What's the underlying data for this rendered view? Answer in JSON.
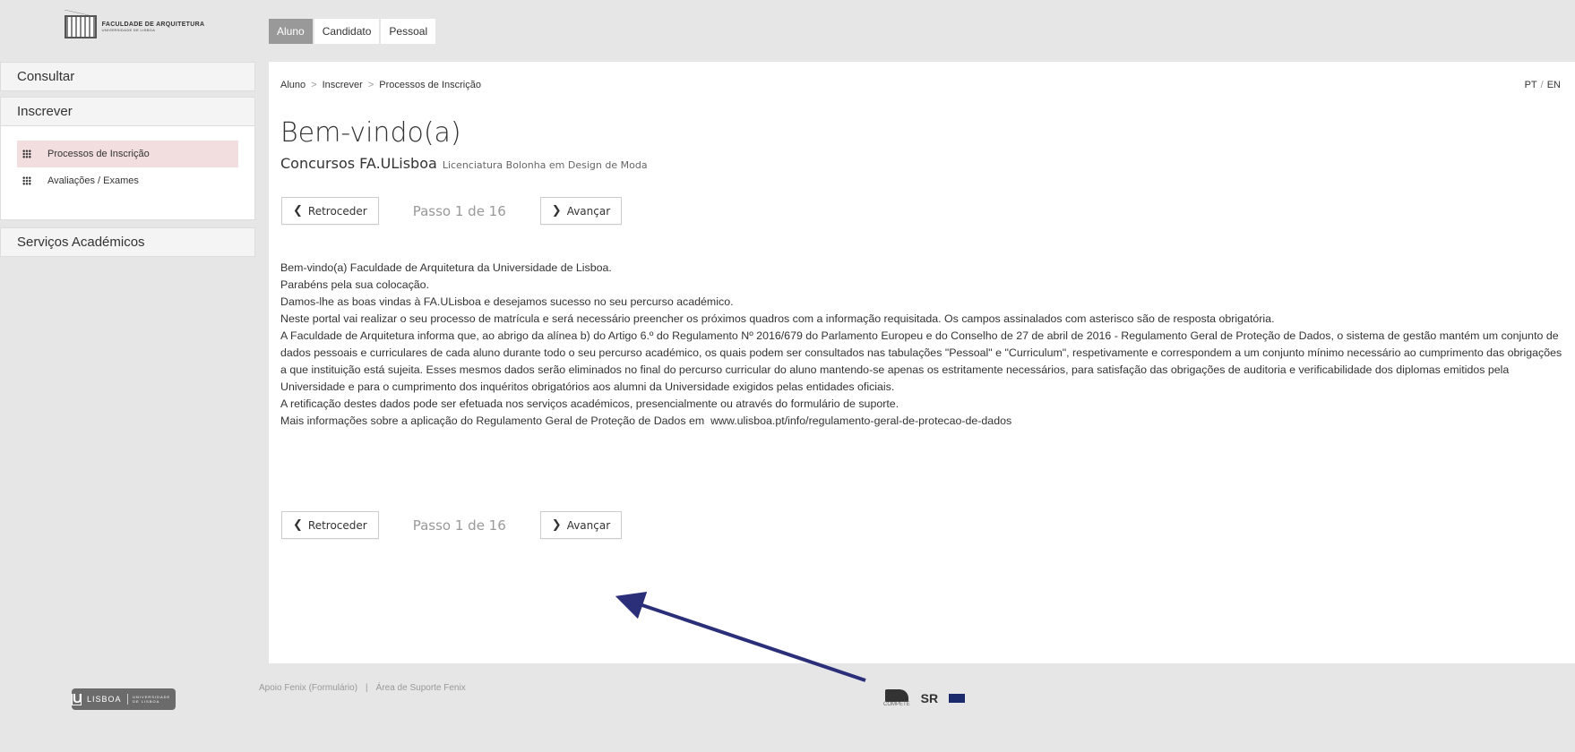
{
  "header": {
    "logo_text": "FACULDADE DE ARQUITETURA",
    "logo_subtext": "UNIVERSIDADE DE LISBOA",
    "tabs": [
      {
        "label": "Aluno",
        "active": true
      },
      {
        "label": "Candidato",
        "active": false
      },
      {
        "label": "Pessoal",
        "active": false
      }
    ]
  },
  "sidebar": {
    "consultar": "Consultar",
    "inscrever": "Inscrever",
    "items": [
      {
        "label": "Processos de Inscrição",
        "active": true
      },
      {
        "label": "Avaliações / Exames",
        "active": false
      }
    ],
    "servicos": "Serviços Académicos"
  },
  "breadcrumb": [
    "Aluno",
    "Inscrever",
    "Processos de Inscrição"
  ],
  "lang": {
    "pt": "PT",
    "en": "EN"
  },
  "page": {
    "title": "Bem-vindo(a)",
    "subtitle": "Concursos FA.ULisboa",
    "subtitle_small": "Licenciatura Bolonha em Design de Moda"
  },
  "nav": {
    "back": "Retroceder",
    "step": "Passo 1 de 16",
    "next": "Avançar"
  },
  "body": [
    "Bem-vindo(a) Faculdade de Arquitetura da Universidade de Lisboa.",
    "Parabéns pela sua colocação.",
    "Damos-lhe as boas vindas à FA.ULisboa e desejamos sucesso no seu percurso académico.",
    "Neste portal vai realizar o seu processo de matrícula e será necessário preencher os próximos quadros com a informação requisitada. Os campos assinalados com asterisco são de resposta obrigatória.",
    "A Faculdade de Arquitetura informa que, ao abrigo da alínea b) do Artigo 6.º do Regulamento Nº 2016/679 do Parlamento Europeu e do Conselho de 27 de abril de 2016 - Regulamento Geral de Proteção de Dados, o sistema de gestão mantém um conjunto de dados pessoais e curriculares de cada aluno durante todo o seu percurso académico, os quais podem ser consultados nas tabulações \"Pessoal\" e \"Curriculum\", respetivamente e correspondem a um conjunto mínimo necessário ao cumprimento das obrigações a que instituição está sujeita. Esses mesmos dados serão eliminados no final do percurso curricular do aluno mantendo-se apenas os estritamente necessários, para satisfação das obrigações de auditoria e verificabilidade dos diplomas emitidos pela Universidade e para o cumprimento dos inquéritos obrigatórios aos alumni da Universidade exigidos pelas entidades oficiais.",
    "A retificação destes dados pode ser efetuada nos serviços académicos, presencialmente ou através do formulário de suporte."
  ],
  "body_last_prefix": "Mais informações sobre a aplicação do Regulamento Geral de Proteção de Dados em",
  "body_link": "www.ulisboa.pt/info/regulamento-geral-de-protecao-de-dados",
  "footer": {
    "lisboa_u": "U",
    "lisboa_text": "LISBOA",
    "lisboa_small": "UNIVERSIDADE DE LISBOA",
    "link1": "Apoio Fenix (Formulário)",
    "sep": "|",
    "link2": "Área de Suporte Fenix",
    "partner1": "COMPETE",
    "partner2": "SR",
    "partner3": ""
  },
  "colors": {
    "active_tab": "#999999",
    "active_side": "#f2dede",
    "arrow": "#2b2f7a"
  }
}
